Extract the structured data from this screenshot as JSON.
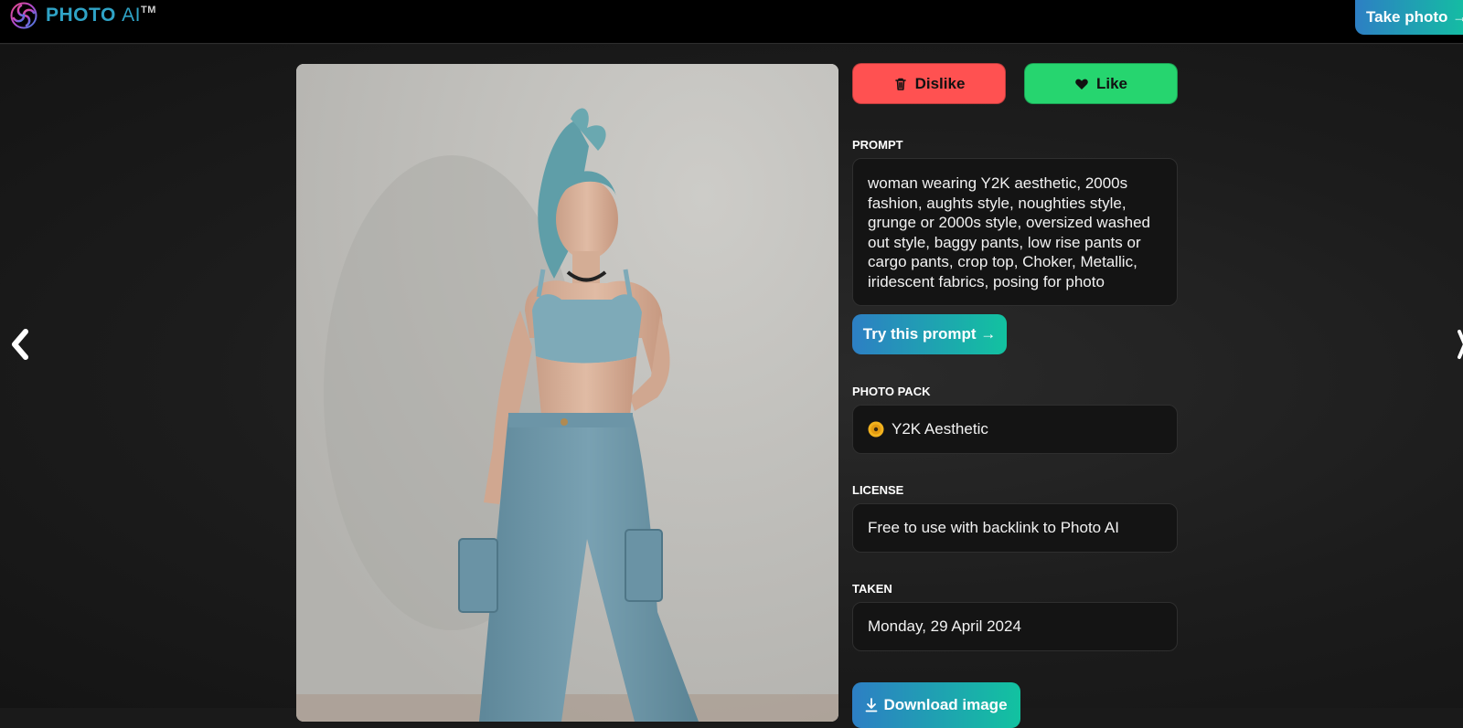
{
  "header": {
    "logo_text": "PHOTO",
    "logo_ai": "AI",
    "logo_tm": "TM",
    "cta_label": "Take photo →"
  },
  "actions": {
    "dislike_label": "Dislike",
    "like_label": "Like"
  },
  "prompt": {
    "label": "PROMPT",
    "text": "woman wearing Y2K aesthetic, 2000s fashion, aughts style, noughties style, grunge or 2000s style, oversized washed out style, baggy pants, low rise pants or cargo pants, crop top, Choker, Metallic, iridescent fabrics, posing for photo",
    "try_label": "Try this prompt →"
  },
  "photo_pack": {
    "label": "PHOTO PACK",
    "value": "Y2K Aesthetic",
    "icon": "disc-icon"
  },
  "license": {
    "label": "LICENSE",
    "value": "Free to use with backlink to Photo AI"
  },
  "taken": {
    "label": "TAKEN",
    "value": "Monday, 29 April 2024"
  },
  "download": {
    "label": "Download image",
    "icon": "download-icon"
  },
  "colors": {
    "dislike": "#ff5151",
    "like": "#26d56f",
    "gradient_start": "#2d7fc4",
    "gradient_end": "#12c2a0",
    "brand": "#2fa3c6"
  }
}
